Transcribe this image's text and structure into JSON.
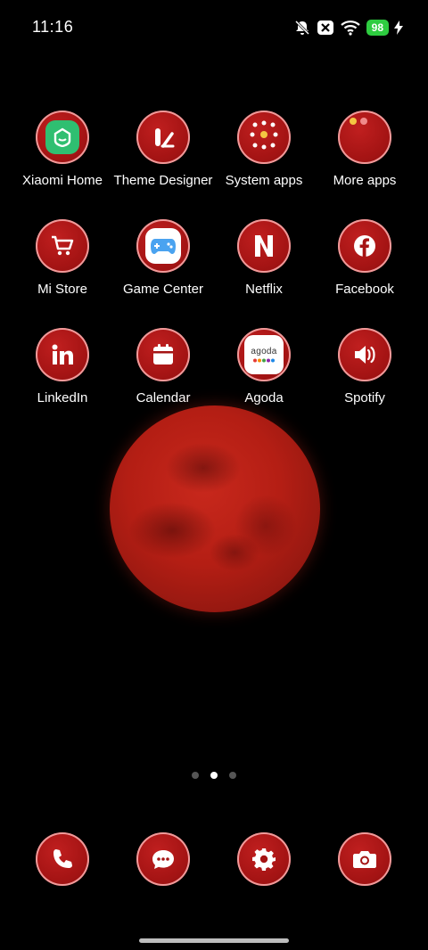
{
  "status_bar": {
    "time": "11:16",
    "battery_level": "98",
    "icons": [
      "mute-icon",
      "notification-x-icon",
      "wifi-icon",
      "battery-icon",
      "charging-icon"
    ]
  },
  "apps": [
    {
      "label": "Xiaomi Home",
      "icon": "xiaomi-home-icon"
    },
    {
      "label": "Theme Designer",
      "icon": "theme-designer-icon"
    },
    {
      "label": "System apps",
      "icon": "folder-icon"
    },
    {
      "label": "More apps",
      "icon": "folder-icon"
    },
    {
      "label": "Mi Store",
      "icon": "cart-icon"
    },
    {
      "label": "Game Center",
      "icon": "gamepad-icon"
    },
    {
      "label": "Netflix",
      "icon": "netflix-icon"
    },
    {
      "label": "Facebook",
      "icon": "facebook-icon"
    },
    {
      "label": "LinkedIn",
      "icon": "linkedin-icon"
    },
    {
      "label": "Calendar",
      "icon": "calendar-icon"
    },
    {
      "label": "Agoda",
      "icon": "agoda-icon",
      "inner_text": "agoda"
    },
    {
      "label": "Spotify",
      "icon": "speaker-icon"
    }
  ],
  "page_indicator": {
    "pages": 3,
    "current": 2
  },
  "dock": [
    {
      "name": "phone",
      "icon": "phone-icon"
    },
    {
      "name": "messages",
      "icon": "message-icon"
    },
    {
      "name": "settings",
      "icon": "gear-icon"
    },
    {
      "name": "camera",
      "icon": "camera-icon"
    }
  ],
  "colors": {
    "icon_red": "#a51414",
    "icon_ring": "#ef9a9a",
    "battery_green": "#2ecc40",
    "xiaomi_green": "#2fbf71",
    "game_blue": "#4aa3f0"
  }
}
